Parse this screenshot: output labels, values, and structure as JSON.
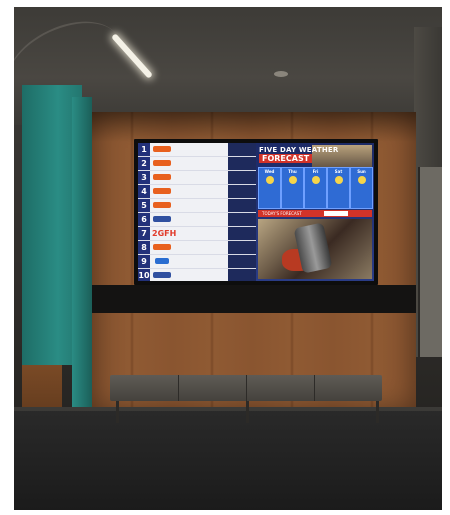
{
  "scene": {
    "description_colors": {
      "wood": "#8a5530",
      "teal": "#2a8c84",
      "screen_navy": "#22317a",
      "accent_red": "#d23329",
      "bench": "#5f5b55"
    }
  },
  "screen": {
    "rows": [
      {
        "num": "1",
        "name": "",
        "label_top": "",
        "label_time": ""
      },
      {
        "num": "2",
        "name": "",
        "label_top": "",
        "label_time": ""
      },
      {
        "num": "3",
        "name": "",
        "label_top": "",
        "label_time": ""
      },
      {
        "num": "4",
        "name": "",
        "label_top": "",
        "label_time": ""
      },
      {
        "num": "5",
        "name": "",
        "label_top": "",
        "label_time": ""
      },
      {
        "num": "6",
        "name": "",
        "label_top": "",
        "label_time": ""
      },
      {
        "num": "7",
        "name": "",
        "label_top": "",
        "label_time": ""
      },
      {
        "num": "8",
        "name": "",
        "label_top": "",
        "label_time": ""
      },
      {
        "num": "9",
        "name": "",
        "label_top": "",
        "label_time": ""
      },
      {
        "num": "10",
        "name": "",
        "label_top": "",
        "label_time": ""
      }
    ],
    "row7_logo": "2GFH",
    "weather": {
      "title_line1": "FIVE DAY WEATHER",
      "title_line2": "FORECAST",
      "days": [
        "Wed",
        "Thu",
        "Fri",
        "Sat",
        "Sun"
      ],
      "bar_text": "TODAY'S FORECAST"
    }
  }
}
